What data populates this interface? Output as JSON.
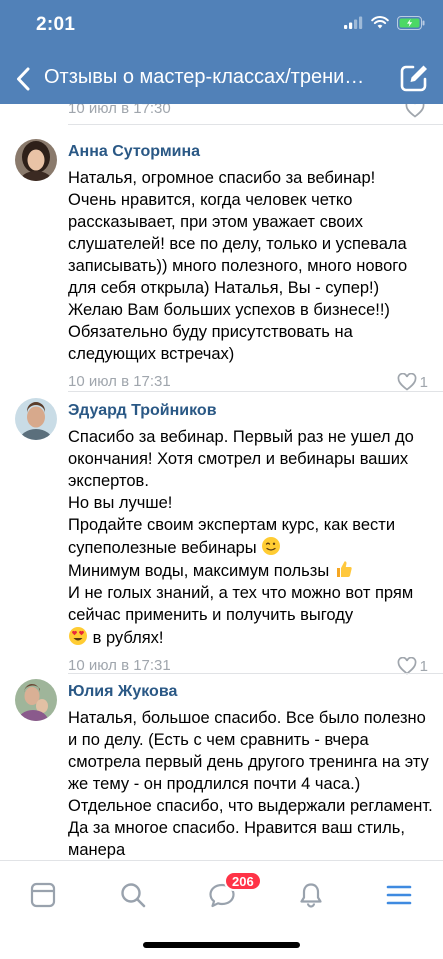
{
  "status_bar": {
    "time": "2:01"
  },
  "header": {
    "title": "Отзывы о мастер-классах/тренингах"
  },
  "previous_comment": {
    "date": "10 июл в 17:30",
    "likes": ""
  },
  "comments": [
    {
      "author": "Анна Сутормина",
      "text": "Наталья, огромное спасибо за вебинар!\nОчень нравится, когда человек четко рассказывает, при этом уважает своих слушателей! все по делу, только и успевала записывать)) много полезного, много нового для себя открыла) Наталья, Вы - супер!) Желаю Вам больших успехов в бизнесе!!) Обязательно буду присутствовать на следующих встречах)",
      "date": "10 июл в 17:31",
      "likes": "1"
    },
    {
      "author": "Эдуард Тройников",
      "lines": [
        "Спасибо за вебинар. Первый раз не ушел до окончания! Хотя смотрел и вебинары ваших экспертов.",
        "Но вы лучше!",
        "Продайте своим экспертам курс, как вести супеполезные вебинары",
        "Минимум воды, максимум пользы",
        "И не голых знаний, а тех что можно вот прям сейчас применить и получить выгоду",
        "в рублях!"
      ],
      "emojis": [
        "winking-face",
        "thumbs-up",
        "heart-eyes-face"
      ],
      "date": "10 июл в 17:31",
      "likes": "1"
    },
    {
      "author": "Юлия Жукова",
      "text": "Наталья, большое спасибо. Все было полезно и по делу. (Есть с чем сравнить - вчера смотрела первый день другого тренинга на эту же тему - он продлился почти 4 часа.) Отдельное спасибо, что выдержали регламент. Да за многое спасибо. Нравится ваш стиль, манера"
    }
  ],
  "tab_bar": {
    "tabs": [
      "news-icon",
      "search-icon",
      "messages-icon",
      "notifications-icon",
      "menu-icon"
    ],
    "messages_badge": "206",
    "active": "menu-icon"
  },
  "colors": {
    "header": "#5181b8",
    "author": "#2a5885",
    "meta": "#a0a6ad",
    "badge": "#ff3347",
    "tab_inactive": "#99a2ad",
    "tab_active": "#3f8ae0"
  }
}
